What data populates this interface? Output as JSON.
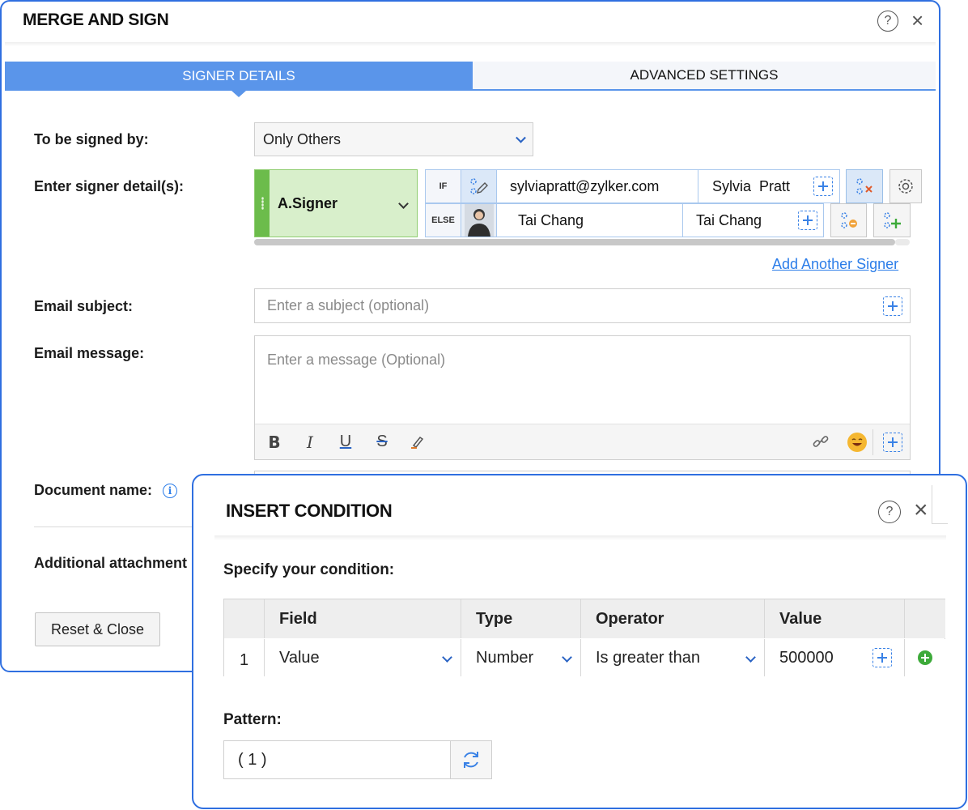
{
  "main_dialog": {
    "title": "MERGE AND SIGN",
    "tabs": [
      {
        "label": "SIGNER DETAILS",
        "active": true
      },
      {
        "label": "ADVANCED SETTINGS",
        "active": false
      }
    ],
    "to_be_signed_by": {
      "label": "To be signed by:",
      "value": "Only Others"
    },
    "signer_details": {
      "label": "Enter signer detail(s):",
      "signer": "A.Signer",
      "if_row": {
        "tag": "IF",
        "email": "sylviapratt@zylker.com",
        "name": "Sylvia  Pratt"
      },
      "else_row": {
        "tag": "ELSE",
        "email": "Tai Chang",
        "name": "Tai Chang"
      }
    },
    "add_signer_link": "Add Another Signer",
    "email_subject": {
      "label": "Email subject:",
      "placeholder": "Enter a subject (optional)"
    },
    "email_message": {
      "label": "Email message:",
      "placeholder": "Enter a message (Optional)"
    },
    "document_name": {
      "label": "Document name:"
    },
    "additional_attachments": {
      "label": "Additional attachment"
    },
    "reset_button": "Reset & Close"
  },
  "condition_dialog": {
    "title": "INSERT CONDITION",
    "specify_label": "Specify your condition:",
    "columns": [
      "Field",
      "Type",
      "Operator",
      "Value"
    ],
    "rows": [
      {
        "index": "1",
        "field": "Value",
        "type": "Number",
        "operator": "Is greater than",
        "value": "500000"
      }
    ],
    "pattern_label": "Pattern:",
    "pattern_value": "( 1 )"
  },
  "colors": {
    "accent": "#5a95ea",
    "border": "#2f6fe0",
    "signer_bg": "#d8efcb",
    "add_green": "#3daa3a"
  }
}
